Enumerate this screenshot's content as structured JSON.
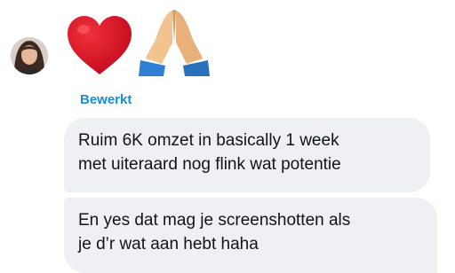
{
  "conversation": {
    "contact_avatar_icon": "contact-avatar",
    "reactions": [
      "red-heart-emoji",
      "folded-hands-emoji"
    ],
    "edited_label": "Bewerkt",
    "messages": [
      {
        "lines": [
          "Ruim 6K omzet in basically 1 week",
          "met uiteraard nog flink wat potentie"
        ]
      },
      {
        "lines": [
          "En yes dat mag je screenshotten als",
          "je d’r wat aan hebt haha"
        ]
      }
    ]
  },
  "colors": {
    "edited_label": "#1a8cd8",
    "bubble_bg": "#eff0f3",
    "text": "#0f1419",
    "heart": "#d4101e",
    "hands": "#f2c28f",
    "sleeve": "#2f7fd4"
  }
}
